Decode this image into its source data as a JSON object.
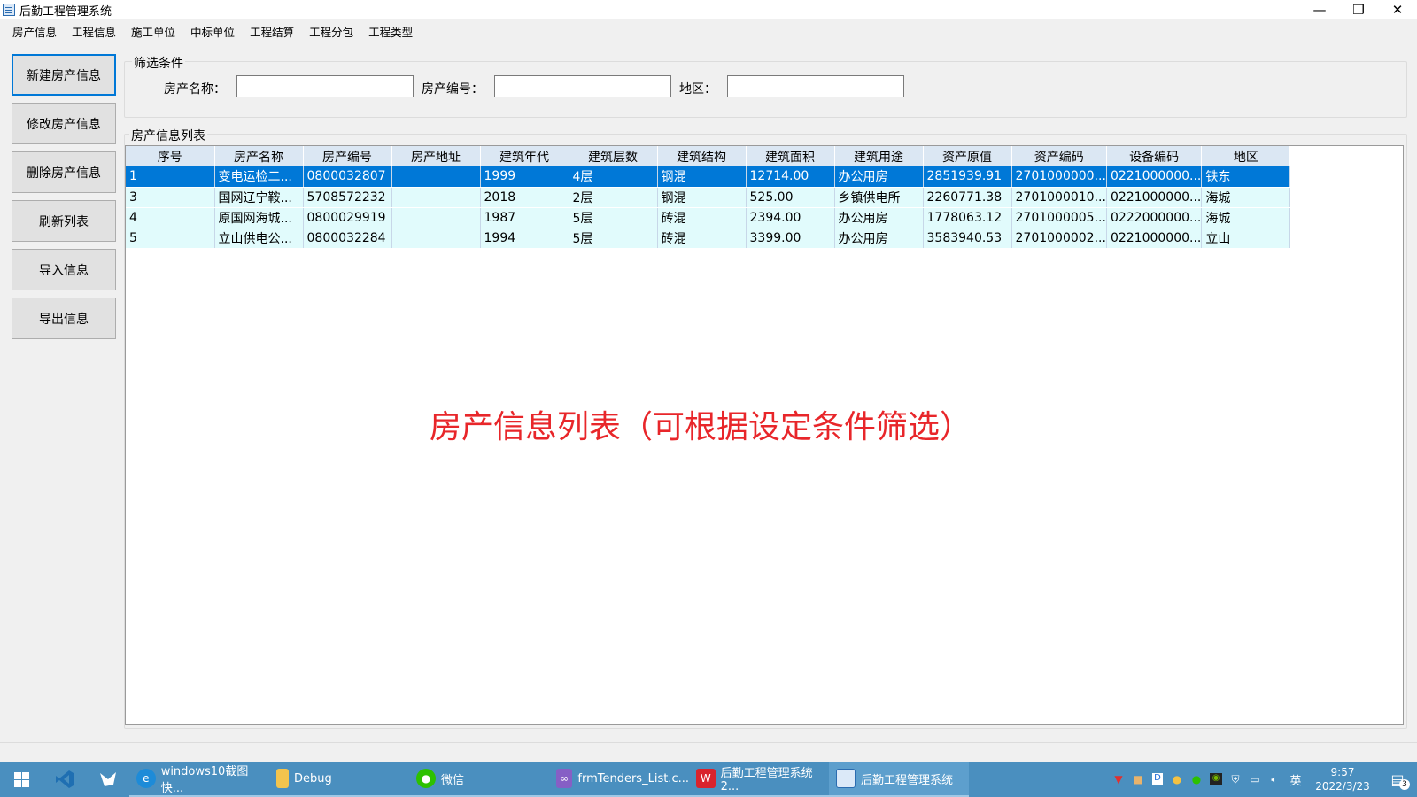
{
  "window": {
    "title": "后勤工程管理系统",
    "minimize": "—",
    "restore": "❐",
    "close": "✕"
  },
  "menu": [
    "房产信息",
    "工程信息",
    "施工单位",
    "中标单位",
    "工程结算",
    "工程分包",
    "工程类型"
  ],
  "sidebar": {
    "buttons": [
      "新建房产信息",
      "修改房产信息",
      "删除房产信息",
      "刷新列表",
      "导入信息",
      "导出信息"
    ]
  },
  "filter": {
    "group_title": "筛选条件",
    "name_label": "房产名称：",
    "name_value": "",
    "code_label": "房产编号：",
    "code_value": "",
    "region_label": "地区：",
    "region_value": ""
  },
  "list": {
    "group_title": "房产信息列表",
    "columns": [
      "序号",
      "房产名称",
      "房产编号",
      "房产地址",
      "建筑年代",
      "建筑层数",
      "建筑结构",
      "建筑面积",
      "建筑用途",
      "资产原值",
      "资产编码",
      "设备编码",
      "地区"
    ],
    "rows": [
      [
        "1",
        "变电运检二...",
        "0800032807",
        "",
        "1999",
        "4层",
        "钢混",
        "12714.00",
        "办公用房",
        "2851939.91",
        "2701000000...",
        "0221000000...",
        "铁东"
      ],
      [
        "3",
        "国网辽宁鞍...",
        "5708572232",
        "",
        "2018",
        "2层",
        "钢混",
        "525.00",
        "乡镇供电所",
        "2260771.38",
        "2701000010...",
        "0221000000...",
        "海城"
      ],
      [
        "4",
        "原国网海城...",
        "0800029919",
        "",
        "1987",
        "5层",
        "砖混",
        "2394.00",
        "办公用房",
        "1778063.12",
        "2701000005...",
        "0222000000...",
        "海城"
      ],
      [
        "5",
        "立山供电公...",
        "0800032284",
        "",
        "1994",
        "5层",
        "砖混",
        "3399.00",
        "办公用房",
        "3583940.53",
        "2701000002...",
        "0221000000...",
        "立山"
      ]
    ],
    "selected_row": 0
  },
  "annotation": "房产信息列表（可根据设定条件筛选）",
  "taskbar": {
    "apps": [
      {
        "label": "windows10截图快...",
        "icon": "edge-icon"
      },
      {
        "label": "Debug",
        "icon": "folder-icon"
      },
      {
        "label": "微信",
        "icon": "wechat-icon"
      },
      {
        "label": "frmTenders_List.c...",
        "icon": "visual-studio-icon"
      },
      {
        "label": "后勤工程管理系统2...",
        "icon": "wps-icon"
      },
      {
        "label": "后勤工程管理系统",
        "icon": "app-icon"
      }
    ],
    "ime": "英",
    "time": "9:57",
    "date": "2022/3/23",
    "notification_count": "3"
  },
  "colors": {
    "selection": "#0078d7",
    "row_bg": "#e1fbfc",
    "header_bg": "#dbe7f3",
    "annotation": "#e8262a",
    "taskbar": "#4a8fbf"
  }
}
